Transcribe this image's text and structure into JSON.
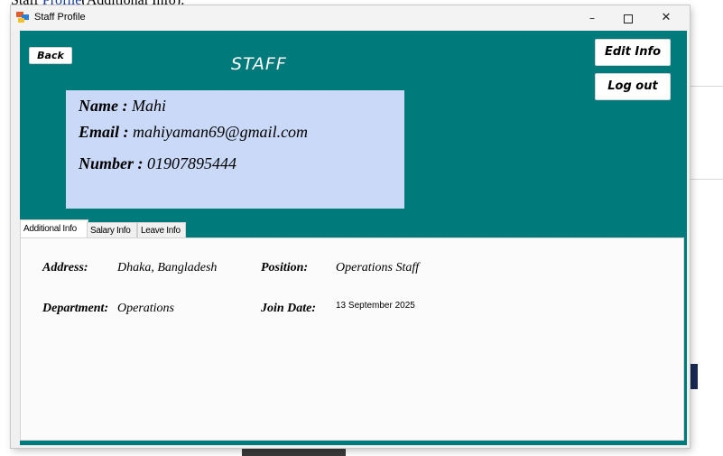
{
  "document": {
    "fragment_prefix": "Staff ",
    "fragment_link": "Profile",
    "fragment_suffix": "(Additional Info):"
  },
  "window": {
    "title": "Staff Profile",
    "controls": {
      "minimize": "–",
      "close": "✕"
    }
  },
  "header": {
    "back_label": "Back",
    "title": "STAFF",
    "edit_label": "Edit Info",
    "logout_label": "Log out"
  },
  "profile": {
    "name_label": "Name :",
    "name_value": "Mahi",
    "email_label": "Email :",
    "email_value": "mahiyaman69@gmail.com",
    "number_label": "Number :",
    "number_value": "01907895444"
  },
  "tabs": [
    {
      "label": "Additional Info",
      "active": true
    },
    {
      "label": "Salary Info",
      "active": false
    },
    {
      "label": "Leave Info",
      "active": false
    }
  ],
  "additional_info": {
    "address_label": "Address:",
    "address_value": "Dhaka, Bangladesh",
    "position_label": "Position:",
    "position_value": "Operations Staff",
    "department_label": "Department:",
    "department_value": "Operations",
    "join_date_label": "Join Date:",
    "join_date_value": "13 September 2025"
  },
  "colors": {
    "client_background": "#007a7a",
    "info_panel": "#c9d9f7",
    "tab_page": "#fbfbfb"
  },
  "icons": [
    "app-icon",
    "minimize-icon",
    "maximize-icon",
    "close-icon"
  ]
}
